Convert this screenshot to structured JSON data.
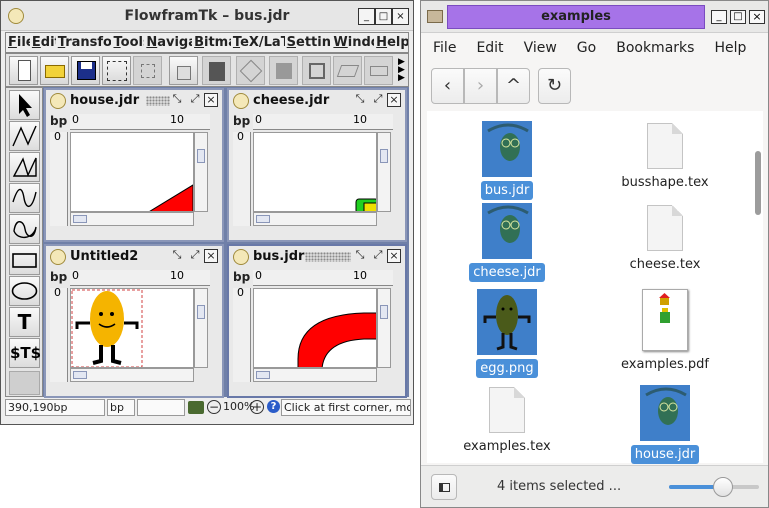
{
  "flowframtk": {
    "title": "FlowframTk – bus.jdr",
    "window_buttons": [
      "_",
      "□",
      "×"
    ],
    "menu": [
      "File",
      "Edit",
      "Transform",
      "Tools",
      "Navigate",
      "Bitmap",
      "TeX/LaTeX",
      "Settings",
      "Window",
      "Help"
    ],
    "tools": {
      "text_tool": "T",
      "math_text_tool": "$T$"
    },
    "documents": [
      {
        "title": "house.jdr",
        "unit": "bp",
        "ruler_h_zero": "0",
        "ruler_h_ten": "10",
        "ruler_v_zero": "0"
      },
      {
        "title": "cheese.jdr",
        "unit": "bp",
        "ruler_h_zero": "0",
        "ruler_h_ten": "10",
        "ruler_v_zero": "0"
      },
      {
        "title": "Untitled2",
        "unit": "bp",
        "ruler_h_zero": "0",
        "ruler_h_ten": "10",
        "ruler_v_zero": "0"
      },
      {
        "title": "bus.jdr",
        "unit": "bp",
        "ruler_h_zero": "0",
        "ruler_h_ten": "10",
        "ruler_v_zero": "0"
      }
    ],
    "status": {
      "coords": "390,190bp",
      "unit": "bp",
      "zoom": "100%",
      "message": "Click at first corner, move"
    }
  },
  "file_manager": {
    "title": "examples",
    "menu": [
      "File",
      "Edit",
      "View",
      "Go",
      "Bookmarks",
      "Help"
    ],
    "nav": {
      "back": "‹",
      "forward": "›",
      "up": "^",
      "reload": "↻"
    },
    "files": [
      {
        "name": "bus.jdr",
        "selected": true,
        "kind": "jdr"
      },
      {
        "name": "busshape.tex",
        "selected": false,
        "kind": "tex"
      },
      {
        "name": "cheese.jdr",
        "selected": true,
        "kind": "jdr"
      },
      {
        "name": "cheese.tex",
        "selected": false,
        "kind": "tex"
      },
      {
        "name": "egg.png",
        "selected": true,
        "kind": "png"
      },
      {
        "name": "examples.pdf",
        "selected": false,
        "kind": "pdf"
      },
      {
        "name": "examples.tex",
        "selected": false,
        "kind": "tex"
      },
      {
        "name": "house.jdr",
        "selected": true,
        "kind": "jdr"
      }
    ],
    "status": "4 items selected ...",
    "zoom_slider_level": 0.6
  },
  "colors": {
    "accent_purple": "#a673e8",
    "selection_blue": "#4a90d9",
    "shape_red": "#ff0000",
    "egg_yellow": "#f5b400"
  }
}
